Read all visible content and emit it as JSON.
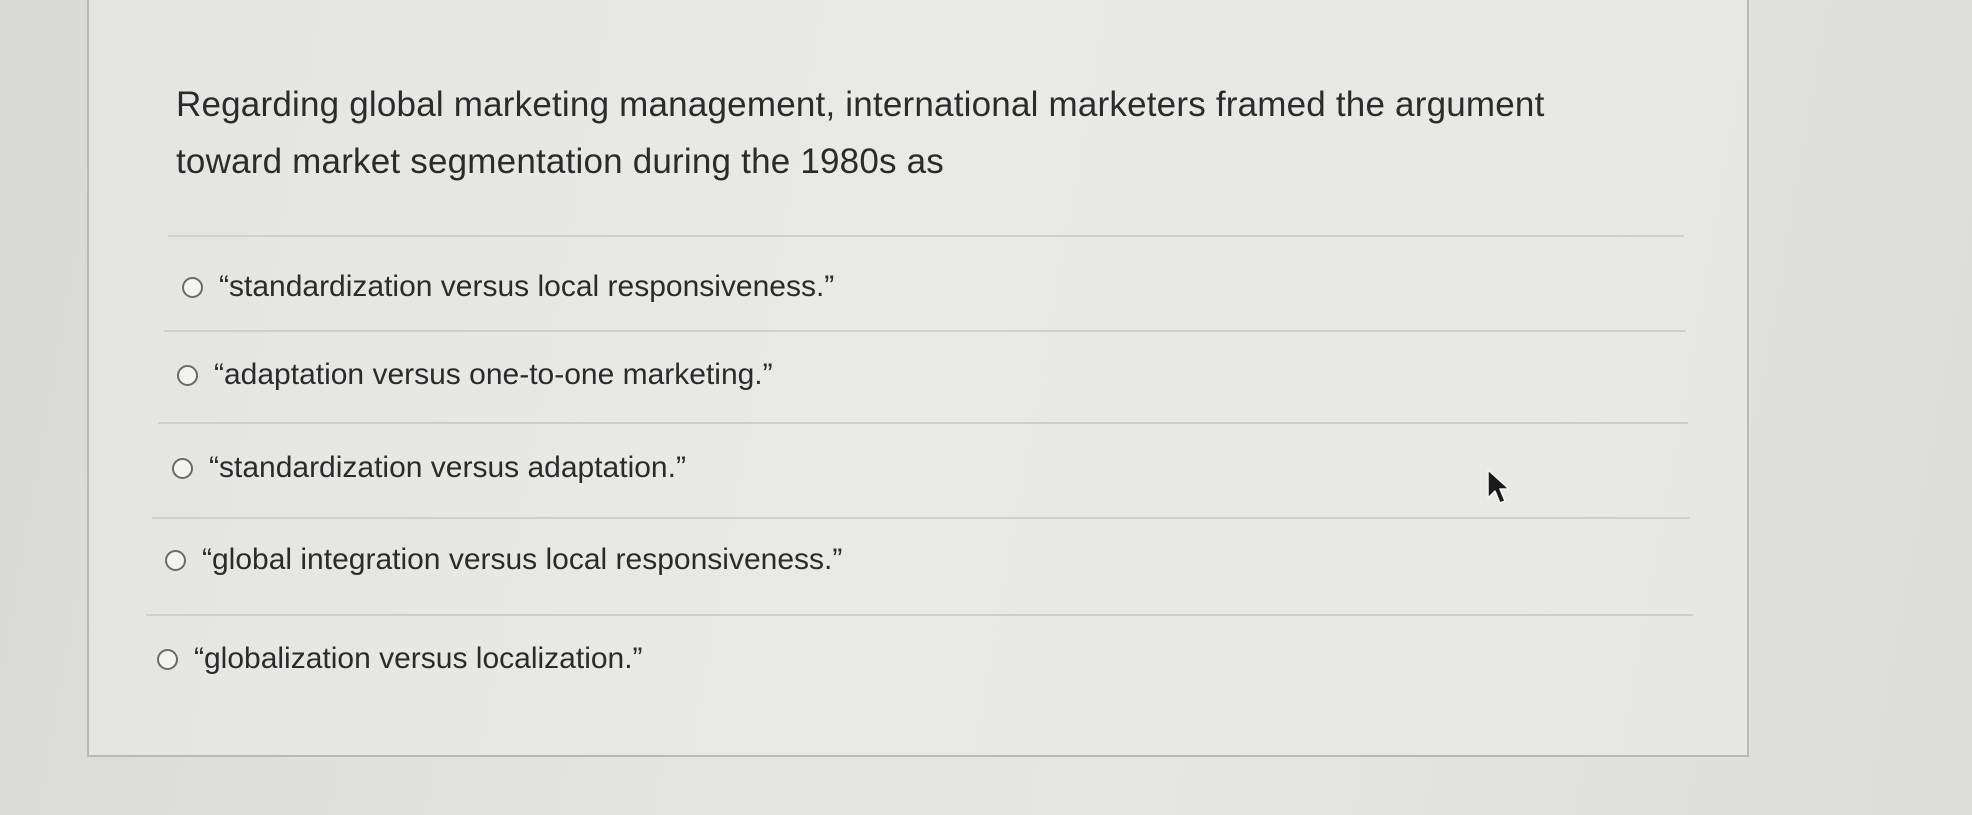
{
  "question": {
    "text": "Regarding global marketing management, international marketers framed the argument toward market segmentation during the 1980s as"
  },
  "options": [
    {
      "label": "“standardization versus local responsiveness.”"
    },
    {
      "label": "“adaptation versus one-to-one marketing.”"
    },
    {
      "label": "“standardization versus adaptation.”"
    },
    {
      "label": "“global integration versus local responsiveness.”"
    },
    {
      "label": "“globalization versus localization.”"
    }
  ],
  "cursor": {
    "icon": "mouse-pointer-icon"
  },
  "colors": {
    "text": "#2b2b2b",
    "radio_border": "#6a6a6a",
    "separator": "#cfcfcd",
    "background": "#e6e6e4"
  }
}
